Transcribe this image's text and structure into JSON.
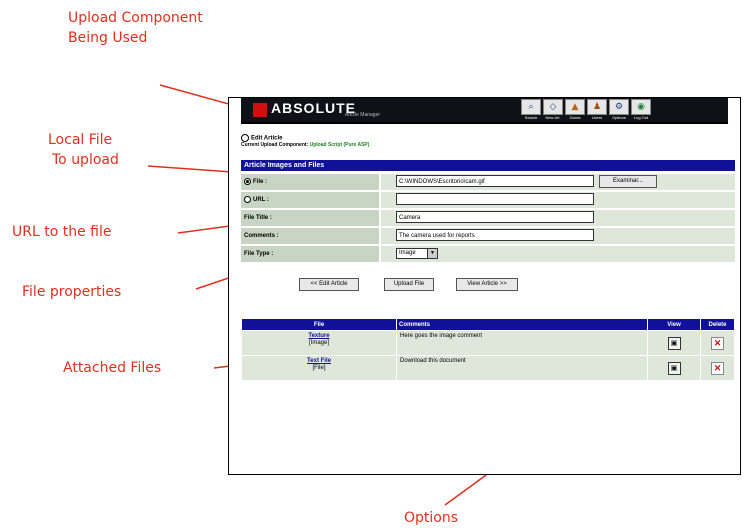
{
  "annotations": {
    "upload_component_line1": "Upload Component",
    "upload_component_line2": "Being Used",
    "local_file_line1": "Local File",
    "local_file_line2": "To upload",
    "url_to_file": "URL to the file",
    "file_properties": "File properties",
    "attached_files": "Attached Files",
    "options": "Options",
    "color": "#e0301e"
  },
  "app": {
    "logo_text": "ABSOLUTE",
    "logo_sub": "Article Manager",
    "toolbar": [
      {
        "label": "Search",
        "icon": "search-icon"
      },
      {
        "label": "New Art.",
        "icon": "new-article-icon"
      },
      {
        "label": "Zones",
        "icon": "zones-icon"
      },
      {
        "label": "Users",
        "icon": "users-icon"
      },
      {
        "label": "Options",
        "icon": "options-icon"
      },
      {
        "label": "Log Out",
        "icon": "logout-icon"
      }
    ]
  },
  "page": {
    "edit_article_link": "Edit Article",
    "current_component_label": "Current Upload Component:",
    "current_component_value": "Upload Script (Pure ASP)",
    "section_title": "Article Images and Files"
  },
  "form": {
    "file_label": "File :",
    "file_value": "C:\\WINDOWS\\Escritorio\\cam.gif",
    "browse_button": "Examinar...",
    "url_label": "URL :",
    "url_value": "",
    "title_label": "File Title :",
    "title_value": "Camera",
    "comments_label": "Comments :",
    "comments_value": "The camera used for reports",
    "type_label": "File Type :",
    "type_value": "Image"
  },
  "buttons": {
    "edit_article": "<< Edit Article",
    "upload_file": "Upload File",
    "view_article": "View Article >>"
  },
  "files_table": {
    "headers": {
      "file": "File",
      "comments": "Comments",
      "view": "View",
      "delete": "Delete"
    },
    "rows": [
      {
        "name": "Texture",
        "type": "[Image]",
        "comment": "Here goes the image comment"
      },
      {
        "name": "Text File",
        "type": "[File]",
        "comment": "Download this document"
      }
    ]
  },
  "colors": {
    "header_bg": "#101018",
    "section_bar": "#10109a",
    "label_bg": "#c8d4c4",
    "cell_bg": "#dfe6da",
    "delete_red": "#d01010"
  }
}
